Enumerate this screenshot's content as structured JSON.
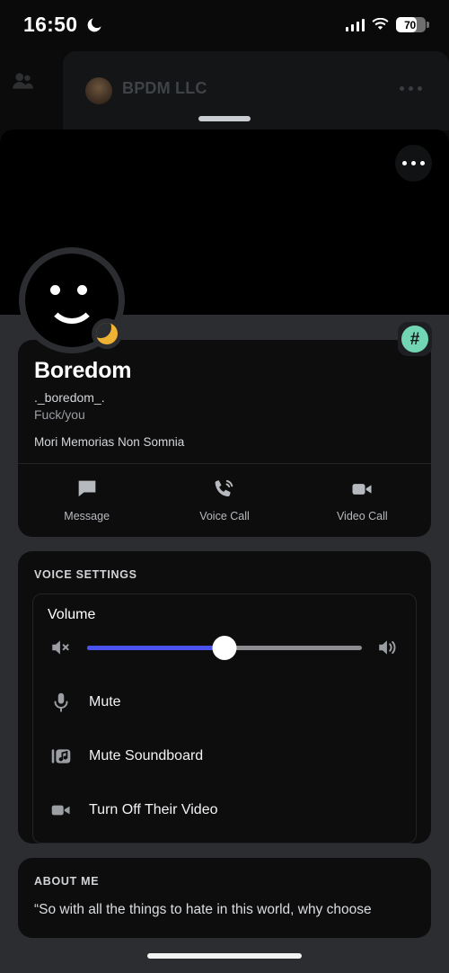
{
  "status_bar": {
    "time": "16:50",
    "moon_icon": "crescent-moon-icon",
    "signal_icon": "cellular-signal-icon",
    "wifi_icon": "wifi-icon",
    "battery_percent": "70",
    "battery_level": 70
  },
  "background_app": {
    "server_name": "BPDM LLC",
    "members_icon": "members-icon",
    "overflow_icon": "more-options-icon"
  },
  "sheet": {
    "drag_handle": "drag-handle",
    "banner_more_button": "more-options-button",
    "avatar": {
      "icon": "smiley-face-avatar",
      "status": "idle",
      "status_icon": "crescent-moon-status-icon"
    },
    "channel_badge": {
      "symbol": "#",
      "color": "#72d5b4"
    }
  },
  "profile": {
    "display_name": "Boredom",
    "username": "._boredom_.",
    "pronouns": "Fuck/you",
    "tagline": "Mori Memorias Non Somnia",
    "actions": [
      {
        "label": "Message",
        "icon": "message-icon"
      },
      {
        "label": "Voice Call",
        "icon": "voice-call-icon"
      },
      {
        "label": "Video Call",
        "icon": "video-call-icon"
      }
    ]
  },
  "voice_settings": {
    "section_title": "VOICE SETTINGS",
    "volume": {
      "label": "Volume",
      "value": 50,
      "mute_icon": "speaker-mute-icon",
      "loud_icon": "speaker-loud-icon",
      "fill_color": "#4b53ef"
    },
    "items": [
      {
        "label": "Mute",
        "icon": "microphone-icon"
      },
      {
        "label": "Mute Soundboard",
        "icon": "soundboard-icon"
      },
      {
        "label": "Turn Off Their Video",
        "icon": "video-camera-icon"
      }
    ]
  },
  "about_me": {
    "section_title": "ABOUT ME",
    "text": "“So with all the things to hate in this world, why choose"
  }
}
